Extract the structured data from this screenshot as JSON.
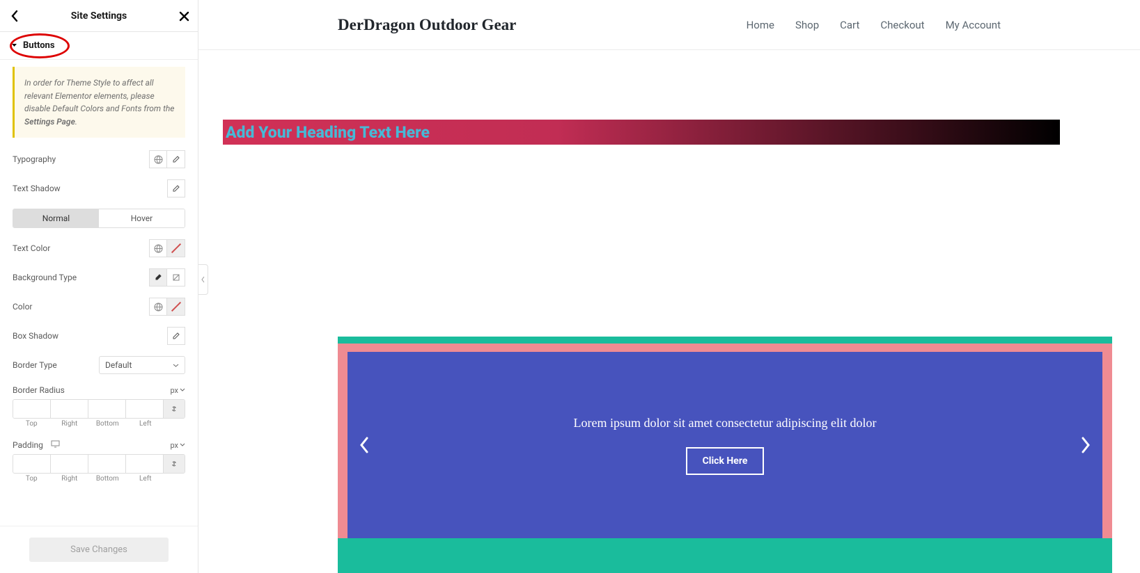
{
  "sidebar": {
    "header_title": "Site Settings",
    "section_label": "Buttons",
    "notice_text": "In order for Theme Style to affect all relevant Elementor elements, please disable Default Colors and Fonts from the ",
    "notice_link": "Settings Page",
    "controls": {
      "typography": "Typography",
      "text_shadow": "Text Shadow",
      "tab_normal": "Normal",
      "tab_hover": "Hover",
      "text_color": "Text Color",
      "background_type": "Background Type",
      "color": "Color",
      "box_shadow": "Box Shadow",
      "border_type": "Border Type",
      "border_type_value": "Default",
      "border_radius": "Border Radius",
      "padding": "Padding",
      "unit_px": "px",
      "dim_top": "Top",
      "dim_right": "Right",
      "dim_bottom": "Bottom",
      "dim_left": "Left"
    },
    "save_button": "Save Changes"
  },
  "preview": {
    "site_title": "DerDragon Outdoor Gear",
    "nav": [
      "Home",
      "Shop",
      "Cart",
      "Checkout",
      "My Account"
    ],
    "heading_text": "Add Your Heading Text Here",
    "slide_text": "Lorem ipsum dolor sit amet consectetur adipiscing elit dolor",
    "cta_label": "Click Here"
  }
}
